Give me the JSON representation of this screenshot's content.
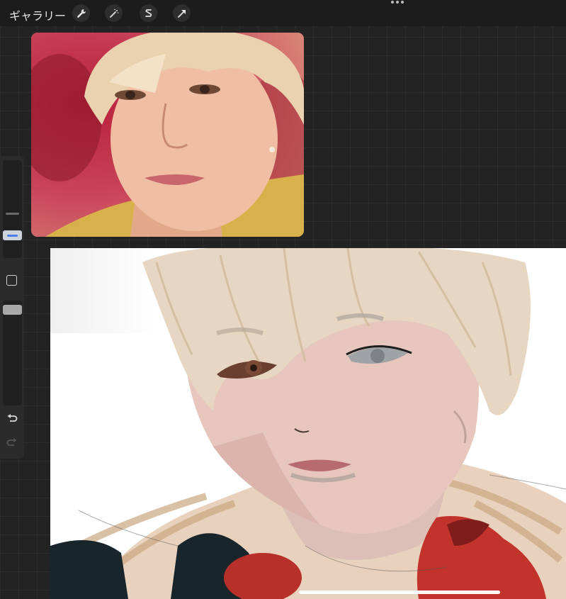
{
  "toolbar": {
    "gallery_label": "ギャラリー",
    "tools": [
      {
        "icon": "wrench-icon"
      },
      {
        "icon": "magic-wand-icon"
      },
      {
        "icon": "selection-s-icon"
      },
      {
        "icon": "transform-arrow-icon"
      }
    ],
    "more_icon": "more-dots-icon"
  },
  "reference_window": {
    "icon": "reference-photo"
  },
  "sidebar": {
    "brush_size_icon": "brush-size-slider",
    "modify_icon": "square-modify-icon",
    "opacity_icon": "opacity-slider",
    "undo_icon": "undo-icon",
    "redo_icon": "redo-icon"
  },
  "colors": {
    "accent": "#4a7ee8",
    "toolbar_bg": "#1c1c1c",
    "canvas_bg": "#ffffff"
  }
}
